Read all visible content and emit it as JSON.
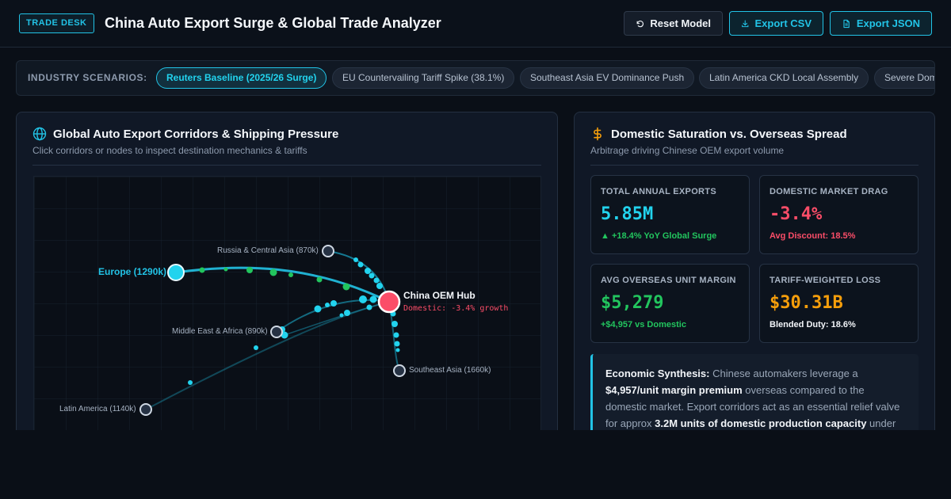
{
  "header": {
    "badge": "TRADE DESK",
    "title": "China Auto Export Surge & Global Trade Analyzer",
    "buttons": {
      "reset": "Reset Model",
      "export_csv": "Export CSV",
      "export_json": "Export JSON"
    }
  },
  "scenarios": {
    "label": "INDUSTRY SCENARIOS:",
    "chips": [
      {
        "label": "Reuters Baseline (2025/26 Surge)",
        "active": true
      },
      {
        "label": "EU Countervailing Tariff Spike (38.1%)",
        "active": false
      },
      {
        "label": "Southeast Asia EV Dominance Push",
        "active": false
      },
      {
        "label": "Latin America CKD Local Assembly",
        "active": false
      },
      {
        "label": "Severe Domestic Price War",
        "active": false
      }
    ]
  },
  "corridors_panel": {
    "title": "Global Auto Export Corridors & Shipping Pressure",
    "subtitle": "Click corridors or nodes to inspect destination mechanics & tariffs",
    "hub": {
      "name": "China OEM Hub",
      "status": "Domestic: -3.4% growth"
    },
    "destinations": [
      {
        "id": "europe",
        "label": "Europe (1290k)",
        "selected": true
      },
      {
        "id": "russia",
        "label": "Russia & Central Asia (870k)",
        "selected": false
      },
      {
        "id": "mea",
        "label": "Middle East & Africa (890k)",
        "selected": false
      },
      {
        "id": "sea",
        "label": "Southeast Asia (1660k)",
        "selected": false
      },
      {
        "id": "latam",
        "label": "Latin America (1140k)",
        "selected": false
      }
    ]
  },
  "saturation_panel": {
    "title": "Domestic Saturation vs. Overseas Spread",
    "subtitle": "Arbitrage driving Chinese OEM export volume",
    "cards": [
      {
        "label": "TOTAL ANNUAL EXPORTS",
        "value": "5.85M",
        "note": "▲ +18.4% YoY Global Surge",
        "value_color": "#22d3ee",
        "note_color": "#22c55e"
      },
      {
        "label": "DOMESTIC MARKET DRAG",
        "value": "-3.4%",
        "note": "Avg Discount: 18.5%",
        "value_color": "#fb4d68",
        "note_color": "#fb4d68"
      },
      {
        "label": "AVG OVERSEAS UNIT MARGIN",
        "value": "$5,279",
        "note": "+$4,957 vs Domestic",
        "value_color": "#22c55e",
        "note_color": "#22c55e"
      },
      {
        "label": "TARIFF-WEIGHTED LOSS",
        "value": "$30.31B",
        "note": "Blended Duty: 18.6%",
        "value_color": "#f59e0b",
        "note_color": "#f2f5f9"
      }
    ],
    "synthesis": {
      "lead": "Economic Synthesis:",
      "t1": " Chinese automakers leverage a ",
      "b1": "$4,957/unit margin premium",
      "t2": " overseas compared to the domestic market. Export corridors act as an essential relief valve for approx ",
      "b2": "3.2M units of domestic production capacity",
      "t3": " under"
    }
  },
  "colors": {
    "accent": "#22c3e6",
    "hub": "#fb4d68",
    "green": "#22c55e",
    "amber": "#f59e0b"
  },
  "icons": {
    "reset": "rotate-ccw-icon",
    "csv": "download-icon",
    "json": "file-icon",
    "globe": "globe-icon",
    "dollar": "dollar-icon"
  }
}
